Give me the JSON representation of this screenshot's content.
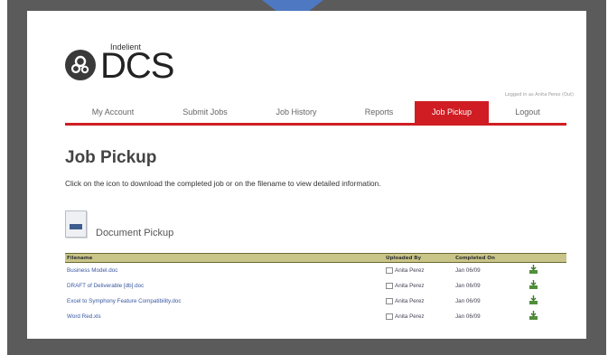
{
  "logo": {
    "small": "Indelient",
    "big": "DCS"
  },
  "header": {
    "login_status": "Logged in as Anita Perez (Out)"
  },
  "nav": {
    "items": [
      {
        "label": "My Account"
      },
      {
        "label": "Submit Jobs"
      },
      {
        "label": "Job History"
      },
      {
        "label": "Reports"
      },
      {
        "label": "Job Pickup"
      },
      {
        "label": "Logout"
      }
    ],
    "active": "Job Pickup"
  },
  "main": {
    "title": "Job Pickup",
    "instructions": "Click on the icon to download the completed job or on the filename to view detailed information.",
    "section_title": "Document Pickup"
  },
  "table": {
    "headers": {
      "filename": "Filename",
      "uploaded_by": "Uploaded By",
      "completed_on": "Completed On"
    },
    "rows": [
      {
        "filename": "Business Model.doc",
        "uploaded_by": "Anita Perez",
        "completed_on": "Jan 06/09"
      },
      {
        "filename": "DRAFT of Deliverable [db].doc",
        "uploaded_by": "Anita Perez",
        "completed_on": "Jan 06/09"
      },
      {
        "filename": "Excel to Symphony Feature Compatibility.doc",
        "uploaded_by": "Anita Perez",
        "completed_on": "Jan 06/09"
      },
      {
        "filename": "Word Red.xls",
        "uploaded_by": "Anita Perez",
        "completed_on": "Jan 06/09"
      }
    ]
  },
  "colors": {
    "accent_red": "#cf1d23",
    "pointer_blue": "#4e78c1",
    "header_olive": "#c9c588",
    "frame_gray": "#5b5b5b"
  },
  "icons": {
    "logo": "gear-cluster-icon",
    "document": "document-icon",
    "user": "user-icon",
    "download": "download-icon"
  }
}
